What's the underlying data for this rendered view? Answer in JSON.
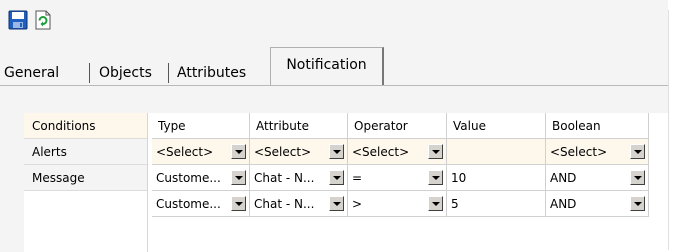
{
  "toolbar": {
    "save_icon": "save-icon",
    "refresh_icon": "refresh-icon"
  },
  "tabs": [
    {
      "label": "General"
    },
    {
      "label": "Objects"
    },
    {
      "label": "Attributes"
    },
    {
      "label": "Notification",
      "active": true
    }
  ],
  "sidebar": {
    "items": [
      {
        "label": "Conditions"
      },
      {
        "label": "Alerts"
      },
      {
        "label": "Message"
      }
    ]
  },
  "grid": {
    "columns": [
      "Type",
      "Attribute",
      "Operator",
      "Value",
      "Boolean"
    ],
    "rows": [
      [
        "<Select>",
        "<Select>",
        "<Select>",
        "",
        "<Select>"
      ],
      [
        "Custome...",
        "Chat - N...",
        "=",
        "10",
        "AND"
      ],
      [
        "Custome...",
        "Chat - N...",
        ">",
        "5",
        "AND"
      ]
    ]
  },
  "colors": {
    "accent": "#1f5fbf",
    "row_highlight": "#fdf7ec",
    "panel_bg": "#f4f4f4"
  }
}
